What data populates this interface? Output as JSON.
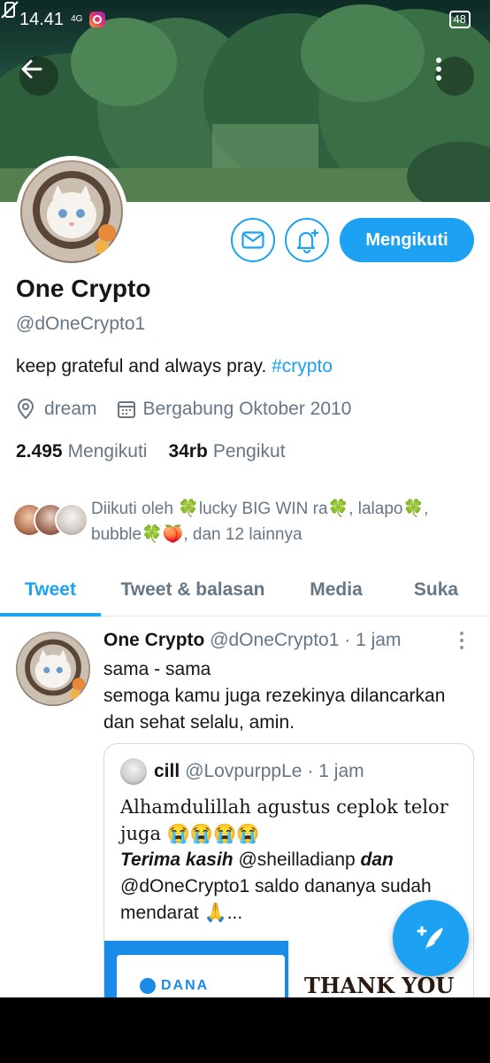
{
  "status_bar": {
    "time": "14.41",
    "network": "4G",
    "battery": "48"
  },
  "profile": {
    "name": "One Crypto",
    "handle": "@dOneCrypto1",
    "bio_text": "keep grateful and always pray.",
    "bio_hashtag": "#crypto",
    "location": "dream",
    "joined": "Bergabung Oktober 2010",
    "following_count": "2.495",
    "following_label": "Mengikuti",
    "followers_count": "34rb",
    "followers_label": "Pengikut",
    "follow_button_label": "Mengikuti",
    "followed_by": "Diikuti oleh 🍀lucky BIG WIN ra🍀, lalapo🍀, bubble🍀🍑, dan 12 lainnya"
  },
  "tabs": [
    {
      "label": "Tweet",
      "active": true
    },
    {
      "label": "Tweet & balasan",
      "active": false
    },
    {
      "label": "Media",
      "active": false
    },
    {
      "label": "Suka",
      "active": false
    }
  ],
  "tweet": {
    "author_name": "One Crypto",
    "author_handle": "@dOneCrypto1",
    "time": "· 1 jam",
    "line1": "sama - sama",
    "line2": "semoga kamu juga rezekinya dilancarkan dan sehat selalu, amin.",
    "quote": {
      "author_name": "cill",
      "author_handle": "@LovpurppLe",
      "time": "· 1 jam",
      "fancy_line": "Alhamdulillah agustus ceplok telor juga 😭😭😭😭",
      "bold_1": "Terima kasih",
      "mention_1": " @sheilladianp ",
      "bold_2": "dan",
      "rest": " @dOneCrypto1 saldo dananya sudah mendarat 🙏...",
      "image_left_text": "DANA",
      "image_right_text": "THANK YOU"
    }
  },
  "colors": {
    "accent": "#1da1f2",
    "text": "#14171a",
    "muted": "#657786"
  },
  "icons": [
    "back-arrow-icon",
    "more-vertical-icon",
    "message-icon",
    "bell-plus-icon",
    "location-pin-icon",
    "calendar-icon",
    "compose-tweet-icon"
  ]
}
